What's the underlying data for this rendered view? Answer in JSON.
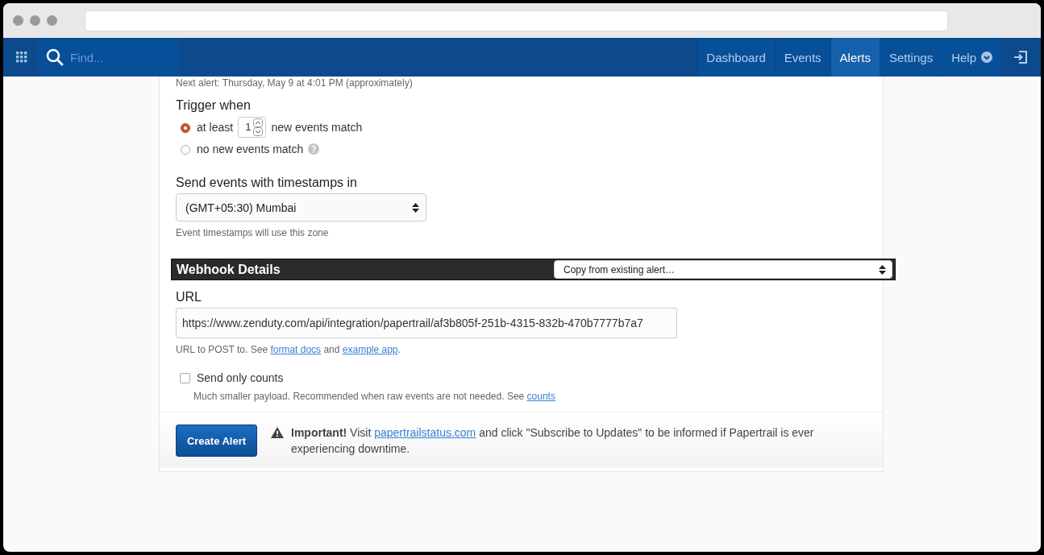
{
  "nav": {
    "search_placeholder": "Find...",
    "items": [
      {
        "label": "Dashboard",
        "selected": false
      },
      {
        "label": "Events",
        "selected": false
      },
      {
        "label": "Alerts",
        "selected": true
      },
      {
        "label": "Settings",
        "selected": false
      },
      {
        "label": "Help",
        "selected": false,
        "dropdown": true
      }
    ]
  },
  "next_alert": "Next alert: Thursday, May 9 at 4:01 PM (approximately)",
  "trigger": {
    "title": "Trigger when",
    "options": [
      {
        "kind": "count",
        "before": "at least",
        "value": "1",
        "after": "new events match",
        "selected": true
      },
      {
        "kind": "none",
        "before": "no new events match",
        "selected": false,
        "help": true
      }
    ]
  },
  "timezone": {
    "title": "Send events with timestamps in",
    "value": "(GMT+05:30) Mumbai",
    "hint": "Event timestamps will use this zone"
  },
  "webhook": {
    "title": "Webhook Details",
    "copy_select": "Copy from existing alert…",
    "url_label": "URL",
    "url_value": "https://www.zenduty.com/api/integration/papertrail/af3b805f-251b-4315-832b-470b7777b7a7",
    "url_hint": [
      {
        "text": "URL to POST to. See "
      },
      {
        "text": "format docs",
        "link": true
      },
      {
        "text": " and "
      },
      {
        "text": "example app",
        "link": true
      },
      {
        "text": "."
      }
    ],
    "counts": {
      "label": "Send only counts",
      "checked": false
    },
    "counts_hint": [
      {
        "text": "Much smaller payload. Recommended when raw events are not needed. See "
      },
      {
        "text": "counts",
        "link": true
      }
    ]
  },
  "footer": {
    "button": "Create Alert",
    "notice": [
      {
        "text": "**Important!** Visit "
      },
      {
        "text": "papertrailstatus.com",
        "link": true
      },
      {
        "text": " and click \"Subscribe to Updates\" to be informed if Papertrail is ever experiencing downtime."
      }
    ]
  }
}
